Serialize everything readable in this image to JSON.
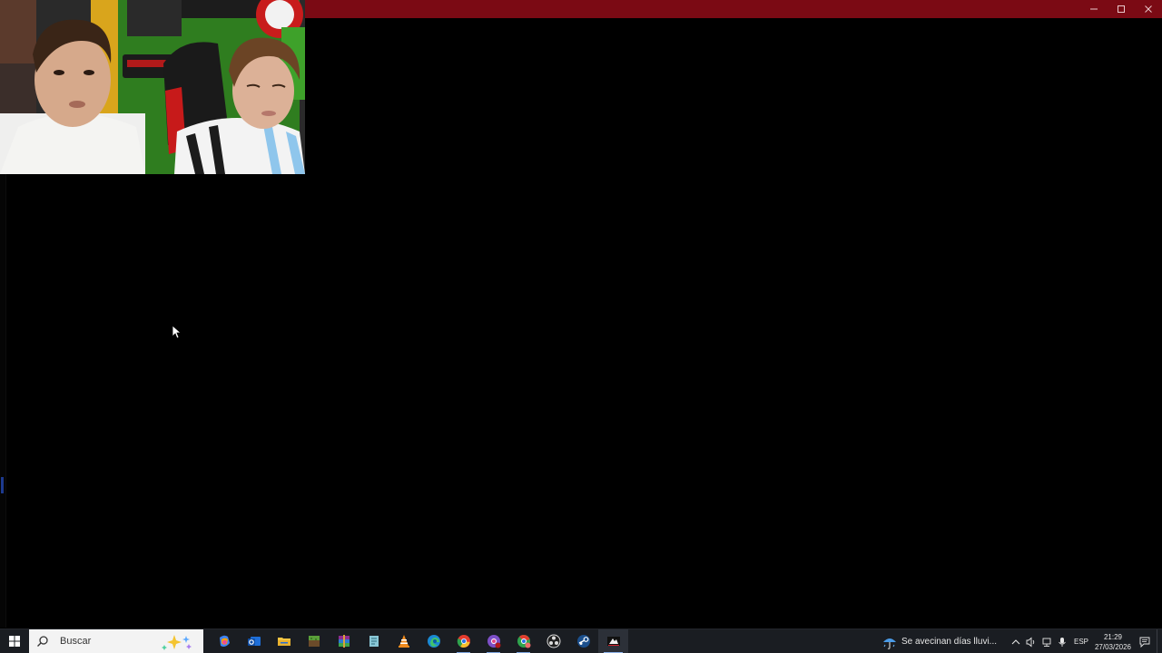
{
  "window": {
    "titlebar_color": "#7b0a14",
    "controls": [
      "minimize-icon",
      "maximize-icon",
      "close-icon"
    ]
  },
  "webcam": {
    "description_icon": "webcam-overlay"
  },
  "taskbar": {
    "search": {
      "placeholder": "Buscar"
    },
    "pinned_apps": [
      "copilot-icon",
      "outlook-icon",
      "file-explorer-icon",
      "minecraft-icon",
      "winrar-icon",
      "notepad-icon",
      "vlc-icon",
      "edge-icon",
      "chrome-icon",
      "chrome-profile-icon",
      "chrome-alt-icon",
      "obs-icon",
      "steam-icon",
      "app-active-icon"
    ],
    "weather": {
      "text": "Se avecinan días lluvi..."
    },
    "tray": {
      "language": "ESP",
      "time": "21:29",
      "date": "27/03/2026"
    }
  }
}
